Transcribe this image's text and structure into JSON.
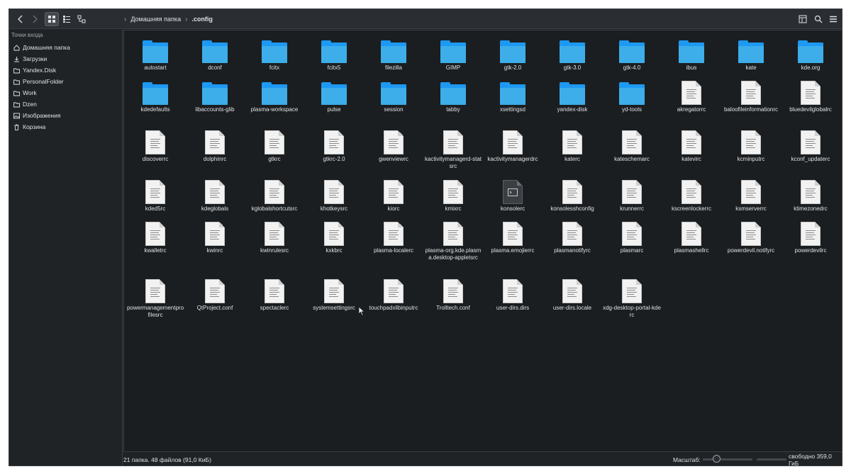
{
  "toolbar": {
    "breadcrumb": [
      "Домашняя папка",
      ".config"
    ]
  },
  "sidebar": {
    "title": "Точки входа",
    "items": [
      {
        "label": "Домашняя папка",
        "icon": "home-icon"
      },
      {
        "label": "Загрузки",
        "icon": "download-icon"
      },
      {
        "label": "Yandex.Disk",
        "icon": "folder-icon"
      },
      {
        "label": "PersonalFolder",
        "icon": "folder-icon"
      },
      {
        "label": "Work",
        "icon": "folder-icon"
      },
      {
        "label": "Dzen",
        "icon": "folder-icon"
      },
      {
        "label": "Изображения",
        "icon": "image-icon"
      },
      {
        "label": "Корзина",
        "icon": "trash-icon"
      }
    ]
  },
  "items": [
    {
      "name": "autostart",
      "kind": "folder"
    },
    {
      "name": "dconf",
      "kind": "folder"
    },
    {
      "name": "fcitx",
      "kind": "folder"
    },
    {
      "name": "fcitx5",
      "kind": "folder"
    },
    {
      "name": "filezilla",
      "kind": "folder"
    },
    {
      "name": "GIMP",
      "kind": "folder"
    },
    {
      "name": "gtk-2.0",
      "kind": "folder"
    },
    {
      "name": "gtk-3.0",
      "kind": "folder"
    },
    {
      "name": "gtk-4.0",
      "kind": "folder"
    },
    {
      "name": "ibus",
      "kind": "folder"
    },
    {
      "name": "kate",
      "kind": "folder"
    },
    {
      "name": "kde.org",
      "kind": "folder"
    },
    {
      "name": "kdedefaults",
      "kind": "folder"
    },
    {
      "name": "libaccounts-glib",
      "kind": "folder"
    },
    {
      "name": "plasma-workspace",
      "kind": "folder"
    },
    {
      "name": "pulse",
      "kind": "folder"
    },
    {
      "name": "session",
      "kind": "folder"
    },
    {
      "name": "tabby",
      "kind": "folder"
    },
    {
      "name": "xsettingsd",
      "kind": "folder"
    },
    {
      "name": "yandex-disk",
      "kind": "folder"
    },
    {
      "name": "yd-tools",
      "kind": "folder"
    },
    {
      "name": "akregatorrc",
      "kind": "file"
    },
    {
      "name": "baloofileinformationrc",
      "kind": "file"
    },
    {
      "name": "bluedevilglobalrc",
      "kind": "file"
    },
    {
      "name": "discoverrc",
      "kind": "file"
    },
    {
      "name": "dolphinrc",
      "kind": "file"
    },
    {
      "name": "gtkrc",
      "kind": "file"
    },
    {
      "name": "gtkrc-2.0",
      "kind": "file"
    },
    {
      "name": "gwenviewrc",
      "kind": "file"
    },
    {
      "name": "kactivitymanagerd-statsrc",
      "kind": "file"
    },
    {
      "name": "kactivitymanagerdrc",
      "kind": "file"
    },
    {
      "name": "katerc",
      "kind": "file"
    },
    {
      "name": "kateschemarc",
      "kind": "file"
    },
    {
      "name": "katevirc",
      "kind": "file"
    },
    {
      "name": "kcminputrc",
      "kind": "file"
    },
    {
      "name": "kconf_updaterc",
      "kind": "file"
    },
    {
      "name": "kded5rc",
      "kind": "file"
    },
    {
      "name": "kdeglobals",
      "kind": "file"
    },
    {
      "name": "kglobalshortcutsrc",
      "kind": "file"
    },
    {
      "name": "khotkeysrc",
      "kind": "file"
    },
    {
      "name": "kiorc",
      "kind": "file"
    },
    {
      "name": "kmixrc",
      "kind": "file"
    },
    {
      "name": "konsolerc",
      "kind": "file-dark"
    },
    {
      "name": "konsolesshconfig",
      "kind": "file"
    },
    {
      "name": "krunnerrc",
      "kind": "file"
    },
    {
      "name": "kscreenlockerrc",
      "kind": "file"
    },
    {
      "name": "ksmserverrc",
      "kind": "file"
    },
    {
      "name": "ktimezonedrc",
      "kind": "file"
    },
    {
      "name": "kwalletrc",
      "kind": "file"
    },
    {
      "name": "kwinrc",
      "kind": "file"
    },
    {
      "name": "kwinrulesrc",
      "kind": "file"
    },
    {
      "name": "kxkbrc",
      "kind": "file"
    },
    {
      "name": "plasma-localerc",
      "kind": "file"
    },
    {
      "name": "plasma-org.kde.plasma.desktop-appletsrc",
      "kind": "file"
    },
    {
      "name": "plasma.emojierrc",
      "kind": "file"
    },
    {
      "name": "plasmanotifyrc",
      "kind": "file"
    },
    {
      "name": "plasmarc",
      "kind": "file"
    },
    {
      "name": "plasmashellrc",
      "kind": "file"
    },
    {
      "name": "powerdevil.notifyrc",
      "kind": "file"
    },
    {
      "name": "powerdevilrc",
      "kind": "file"
    },
    {
      "name": "powermanagementprofilesrc",
      "kind": "file"
    },
    {
      "name": "QtProject.conf",
      "kind": "file"
    },
    {
      "name": "spectaclerc",
      "kind": "file"
    },
    {
      "name": "systemsettingsrc",
      "kind": "file"
    },
    {
      "name": "touchpadxlibinputrc",
      "kind": "file"
    },
    {
      "name": "Trolltech.conf",
      "kind": "file"
    },
    {
      "name": "user-dirs.dirs",
      "kind": "file"
    },
    {
      "name": "user-dirs.locale",
      "kind": "file"
    },
    {
      "name": "xdg-desktop-portal-kderc",
      "kind": "file"
    }
  ],
  "statusbar": {
    "summary": "21 папка. 48 файлов (91,0 КиБ)",
    "zoom_label": "Масштаб:",
    "free_space": "свободно 359,0 ГиБ"
  },
  "colors": {
    "folder_front": "#3daee9",
    "folder_back": "#1d99f3",
    "window_bg": "#202326",
    "view_bg": "#1b1e20"
  }
}
